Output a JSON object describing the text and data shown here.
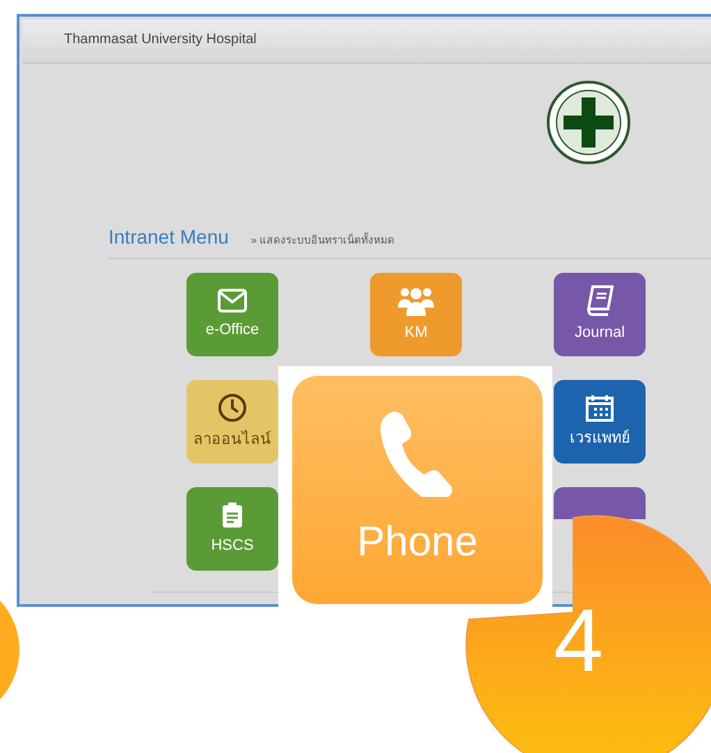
{
  "header": {
    "title": "Thammasat University Hospital"
  },
  "section": {
    "title": "Intranet Menu",
    "link": "» แสดงระบบอินทราเน็ตทั้งหมด"
  },
  "tile_rows": [
    {
      "tiles": [
        {
          "label": "e-Office",
          "kind": "mail",
          "color": "#5b9b36",
          "dark_label": false
        },
        {
          "label": "KM",
          "kind": "people",
          "color": "#ee9a2c",
          "dark_label": false
        },
        {
          "label": "Journal",
          "kind": "book",
          "color": "#7657a8",
          "dark_label": false
        }
      ]
    },
    {
      "tiles": [
        {
          "label": "ลาออนไลน์",
          "kind": "clock",
          "color": "#e3c566",
          "dark_label": true
        },
        {
          "label": "เวรแพทย์",
          "kind": "calendar",
          "color": "#1c64ae",
          "dark_label": false
        }
      ]
    },
    {
      "tiles": [
        {
          "label": "HSCS",
          "kind": "clipboard",
          "color": "#5b9b36",
          "dark_label": false
        },
        {
          "color": "#7657a8",
          "cut": true
        }
      ]
    }
  ],
  "callout": {
    "label": "Phone",
    "kind": "phone"
  },
  "step_badge": {
    "number": "4"
  }
}
